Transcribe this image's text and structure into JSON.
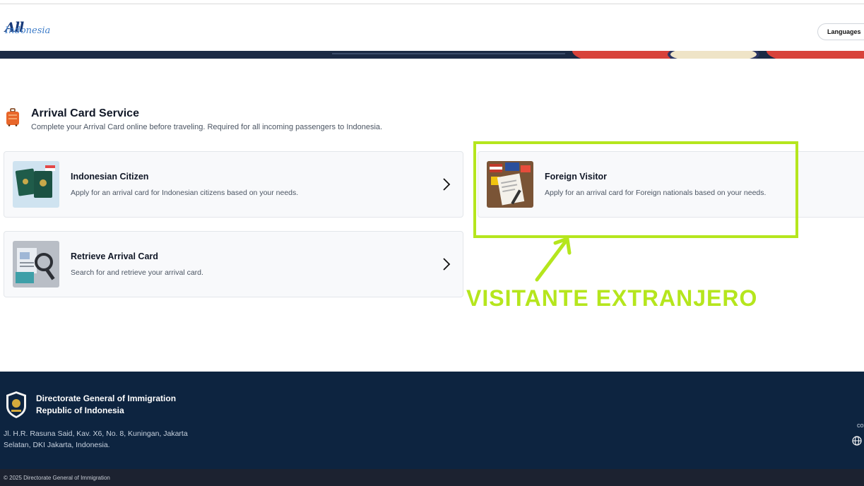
{
  "header": {
    "logo_top": "All",
    "logo_bottom": "Indonesia",
    "languages_label": "Languages"
  },
  "section": {
    "icon": "luggage-icon",
    "title": "Arrival Card Service",
    "subtitle": "Complete your Arrival Card online before traveling. Required for all incoming passengers to Indonesia."
  },
  "cards": [
    {
      "title": "Indonesian Citizen",
      "description": "Apply for an arrival card for Indonesian citizens based on your needs.",
      "image": "passports-image"
    },
    {
      "title": "Foreign Visitor",
      "description": "Apply for an arrival card for Foreign nationals based on your needs.",
      "image": "flags-form-image"
    },
    {
      "title": "Retrieve Arrival Card",
      "description": "Search for and retrieve your arrival card.",
      "image": "magnifier-documents-image"
    }
  ],
  "annotation": {
    "label": "VISITANTE EXTRANJERO",
    "color": "#b5e61d"
  },
  "footer": {
    "org_line1": "Directorate General of Immigration",
    "org_line2": "Republic of Indonesia",
    "address": "Jl. H.R. Rasuna Said, Kav. X6, No. 8, Kuningan, Jakarta Selatan, DKI Jakarta, Indonesia.",
    "right_fragment": "co",
    "copyright": "© 2025 Directorate General of Immigration"
  },
  "colors": {
    "footer_bg": "#0d2440",
    "bottom_bar_bg": "#1c2230",
    "highlight": "#b5e61d"
  }
}
